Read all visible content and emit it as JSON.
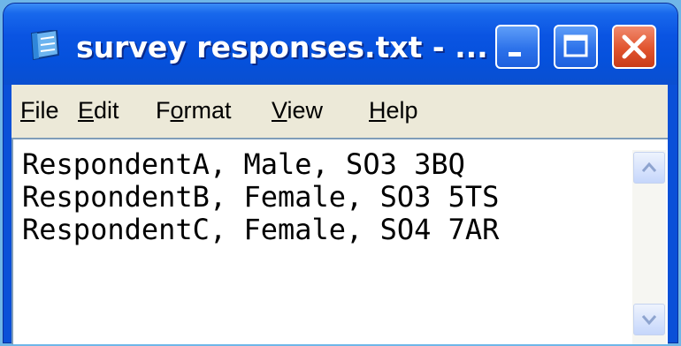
{
  "window": {
    "title": "survey responses.txt - ...",
    "icons": {
      "app": "notepad-icon",
      "minimize": "minimize-icon",
      "maximize": "maximize-icon",
      "close": "close-icon",
      "scroll_up": "chevron-up-icon",
      "scroll_down": "chevron-down-icon"
    },
    "colors": {
      "titlebar": "#0551dc",
      "close_button": "#e1542e",
      "menubar": "#ece9d8"
    }
  },
  "menu": {
    "items": [
      {
        "first": "F",
        "rest": "ile"
      },
      {
        "first": "E",
        "rest": "dit"
      },
      {
        "pre": "F",
        "first": "o",
        "rest": "rmat"
      },
      {
        "first": "V",
        "rest": "iew"
      },
      {
        "first": "H",
        "rest": "elp"
      }
    ]
  },
  "document": {
    "lines": [
      "RespondentA, Male, SO3 3BQ",
      "RespondentB, Female, SO3 5TS",
      "RespondentC, Female, SO4 7AR"
    ]
  }
}
